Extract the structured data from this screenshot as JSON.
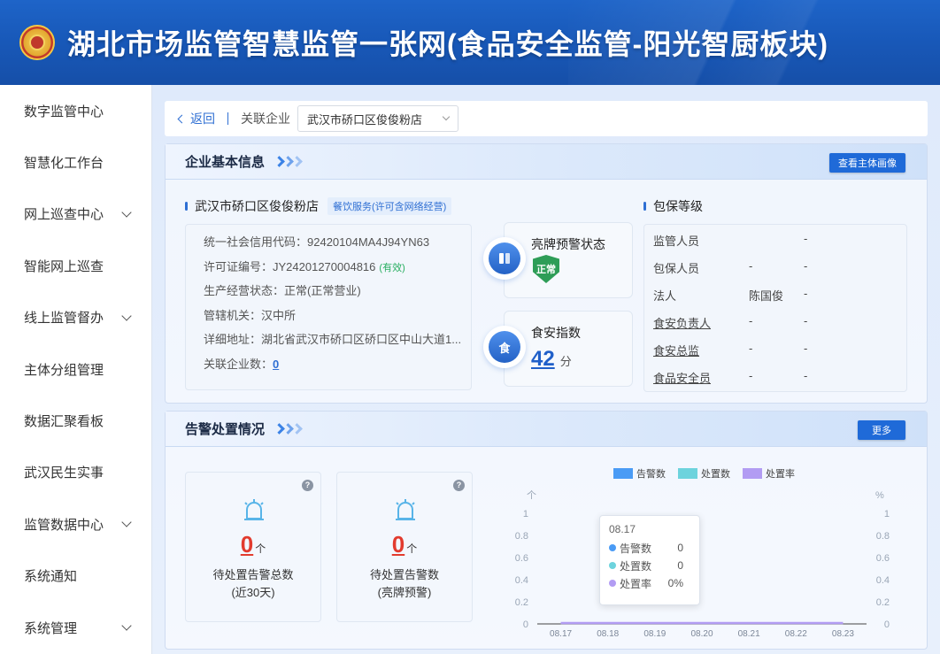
{
  "header": {
    "title": "湖北市场监管智慧监管一张网(食品安全监管-阳光智厨板块)"
  },
  "sidebar": {
    "items": [
      {
        "label": "数字监管中心",
        "expandable": false
      },
      {
        "label": "智慧化工作台",
        "expandable": false
      },
      {
        "label": "网上巡查中心",
        "expandable": true
      },
      {
        "label": "智能网上巡查",
        "expandable": false
      },
      {
        "label": "线上监管督办",
        "expandable": true
      },
      {
        "label": "主体分组管理",
        "expandable": false
      },
      {
        "label": "数据汇聚看板",
        "expandable": false
      },
      {
        "label": "武汉民生实事",
        "expandable": false
      },
      {
        "label": "监管数据中心",
        "expandable": true
      },
      {
        "label": "系统通知",
        "expandable": false
      },
      {
        "label": "系统管理",
        "expandable": true
      }
    ]
  },
  "topbar": {
    "back_label": "返回",
    "related_label": "关联企业",
    "selected_company": "武汉市硚口区俊俊粉店"
  },
  "basic_info": {
    "title": "企业基本信息",
    "profile_button": "查看主体画像",
    "company_name": "武汉市硚口区俊俊粉店",
    "business_tag": "餐饮服务(许可含网络经营)",
    "credit_code": "统一社会信用代码：92420104MA4J94YN63",
    "license_no": "许可证编号：JY24201270004816",
    "license_status": "(有效)",
    "business_status": "生产经营状态：正常(正常营业)",
    "authority": "管辖机关：汉中所",
    "address": "详细地址：湖北省武汉市硚口区硚口区中山大道1...",
    "related_count_label": "关联企业数：",
    "related_count": "0",
    "warning_card": {
      "title": "亮牌预警状态",
      "badge": "正常",
      "icon": "warning-icon"
    },
    "food_index_card": {
      "title": "食安指数",
      "score": "42",
      "unit": "分",
      "icon_text": "食"
    },
    "insurance": {
      "title": "包保等级",
      "rows": [
        {
          "label": "监管人员",
          "v1": "",
          "v2": "-",
          "underline": false
        },
        {
          "label": "包保人员",
          "v1": "-",
          "v2": "-",
          "underline": false
        },
        {
          "label": "法人",
          "v1": "陈国俊",
          "v2": "-",
          "underline": false
        },
        {
          "label": "食安负责人",
          "v1": "-",
          "v2": "-",
          "underline": true
        },
        {
          "label": "食安总监",
          "v1": "-",
          "v2": "-",
          "underline": true
        },
        {
          "label": "食品安全员",
          "v1": "-",
          "v2": "-",
          "underline": true
        }
      ]
    }
  },
  "alarm": {
    "title": "告警处置情况",
    "more_button": "更多",
    "cards": [
      {
        "value": "0",
        "unit": "个",
        "label1": "待处置告警总数",
        "label2": "(近30天)"
      },
      {
        "value": "0",
        "unit": "个",
        "label1": "待处置告警数",
        "label2": "(亮牌预警)"
      }
    ]
  },
  "chart_data": {
    "type": "bar",
    "categories": [
      "08.17",
      "08.18",
      "08.19",
      "08.20",
      "08.21",
      "08.22",
      "08.23"
    ],
    "series": [
      {
        "name": "告警数",
        "values": [
          0,
          0,
          0,
          0,
          0,
          0,
          0
        ],
        "color": "#4a9bf5"
      },
      {
        "name": "处置数",
        "values": [
          0,
          0,
          0,
          0,
          0,
          0,
          0
        ],
        "color": "#6dd3dd"
      },
      {
        "name": "处置率",
        "values": [
          0,
          0,
          0,
          0,
          0,
          0,
          0
        ],
        "color": "#b29cf3"
      }
    ],
    "left_unit": "个",
    "right_unit": "%",
    "left_ticks": [
      "1",
      "0.8",
      "0.6",
      "0.4",
      "0.2",
      "0"
    ],
    "right_ticks": [
      "1",
      "0.8",
      "0.6",
      "0.4",
      "0.2",
      "0"
    ],
    "ylim": [
      0,
      1
    ],
    "tooltip": {
      "date": "08.17",
      "rows": [
        {
          "name": "告警数",
          "value": "0"
        },
        {
          "name": "处置数",
          "value": "0"
        },
        {
          "name": "处置率",
          "value": "0%"
        }
      ]
    }
  }
}
